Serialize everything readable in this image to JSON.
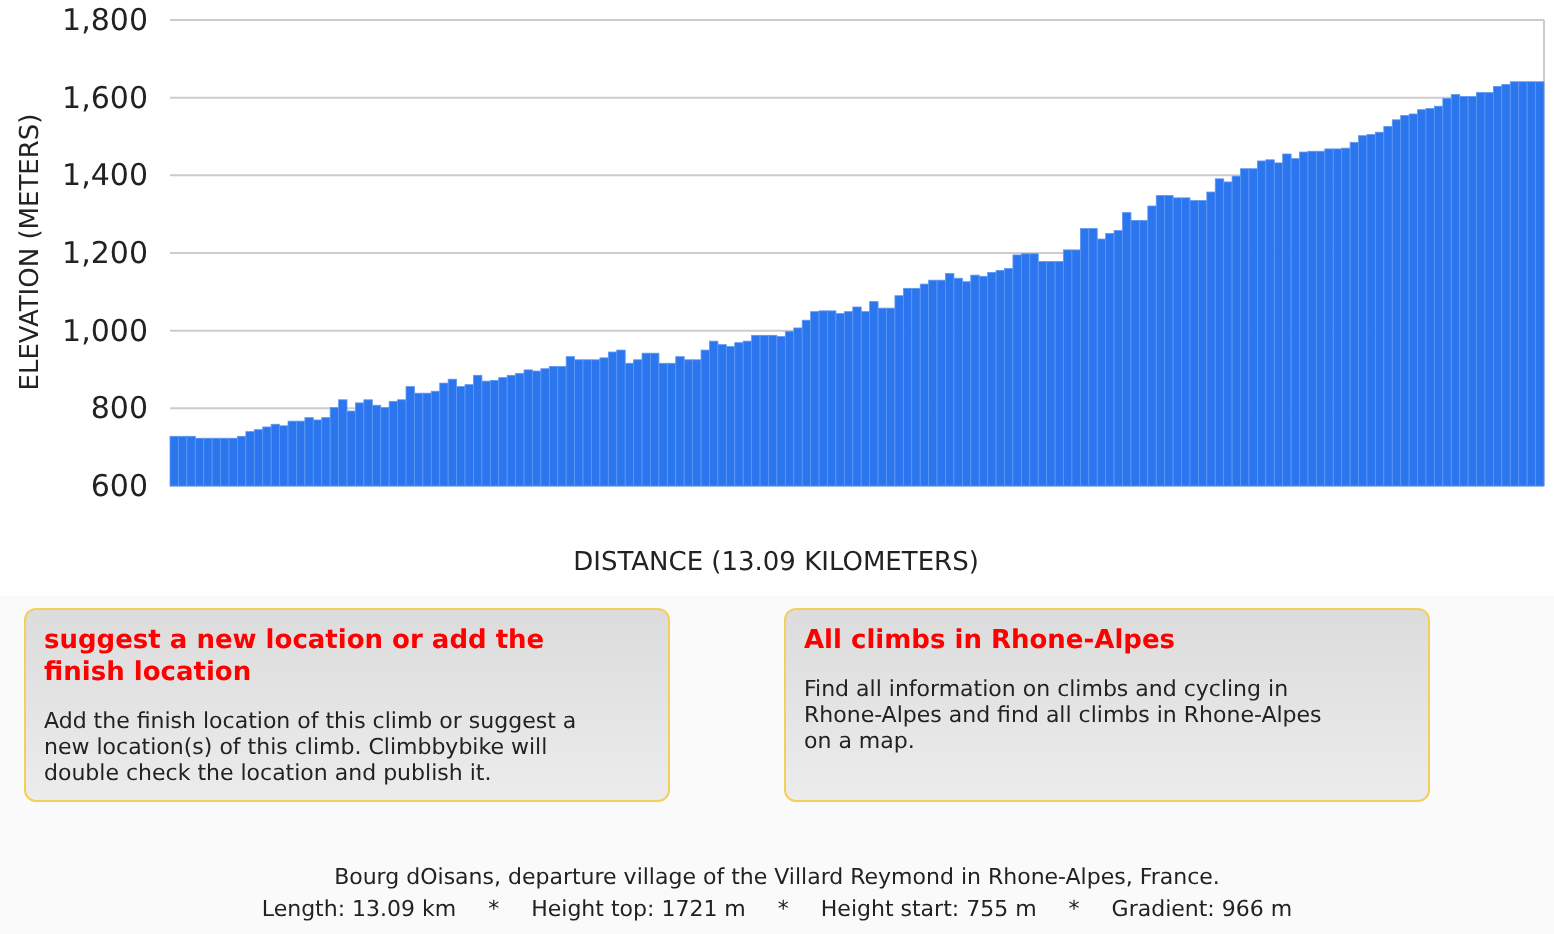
{
  "elevation_chart": {
    "chart_data": {
      "type": "bar",
      "grid": true,
      "ylabel": "ELEVATION (METERS)",
      "xlabel": "DISTANCE (13.09 KILOMETERS)",
      "ylim": [
        600,
        1800
      ],
      "yticks": [
        {
          "value": 1800,
          "label": "1,800"
        },
        {
          "value": 1600,
          "label": "1,600"
        },
        {
          "value": 1400,
          "label": "1,400"
        },
        {
          "value": 1200,
          "label": "1,200"
        },
        {
          "value": 1000,
          "label": "1,000"
        },
        {
          "value": 800,
          "label": "800"
        },
        {
          "value": 600,
          "label": "600"
        }
      ],
      "values": [
        728,
        728,
        728,
        723,
        723,
        723,
        723,
        723,
        728,
        740,
        745,
        752,
        759,
        755,
        767,
        767,
        776,
        770,
        776,
        802,
        822,
        793,
        814,
        822,
        808,
        802,
        818,
        822,
        856,
        839,
        839,
        844,
        865,
        875,
        856,
        861,
        885,
        870,
        872,
        879,
        885,
        890,
        899,
        896,
        902,
        908,
        908,
        933,
        925,
        925,
        925,
        930,
        945,
        950,
        916,
        925,
        942,
        942,
        916,
        916,
        933,
        925,
        925,
        950,
        973,
        964,
        959,
        969,
        973,
        988,
        988,
        988,
        985,
        998,
        1007,
        1027,
        1049,
        1051,
        1051,
        1044,
        1049,
        1061,
        1049,
        1075,
        1058,
        1058,
        1090,
        1109,
        1109,
        1120,
        1130,
        1130,
        1147,
        1135,
        1126,
        1143,
        1140,
        1150,
        1155,
        1160,
        1195,
        1198,
        1198,
        1178,
        1178,
        1178,
        1208,
        1208,
        1263,
        1263,
        1236,
        1250,
        1258,
        1304,
        1284,
        1284,
        1321,
        1348,
        1348,
        1342,
        1342,
        1335,
        1335,
        1357,
        1391,
        1383,
        1398,
        1417,
        1417,
        1437,
        1440,
        1432,
        1455,
        1443,
        1460,
        1462,
        1462,
        1468,
        1468,
        1470,
        1485,
        1502,
        1505,
        1511,
        1526,
        1543,
        1554,
        1558,
        1569,
        1572,
        1578,
        1598,
        1608,
        1603,
        1603,
        1613,
        1613,
        1629,
        1634,
        1641,
        1641,
        1641,
        1641
      ]
    }
  },
  "info_boxes": [
    {
      "title": "suggest a new location or add the finish location",
      "text": "Add the finish location of this climb or suggest a new location(s) of this climb. Climbbybike will double check the location and publish it."
    },
    {
      "title": "All climbs in Rhone-Alpes",
      "text": "Find all information on climbs and cycling in Rhone-Alpes and find all climbs in Rhone-Alpes on a map."
    }
  ],
  "footer": {
    "description": "Bourg dOisans, departure village of the Villard Reymond in Rhone-Alpes, France.",
    "stats": [
      "Length: 13.09 km",
      "*",
      "Height top: 1721 m",
      "*",
      "Height start: 755 m",
      "*",
      "Gradient: 966 m"
    ]
  }
}
